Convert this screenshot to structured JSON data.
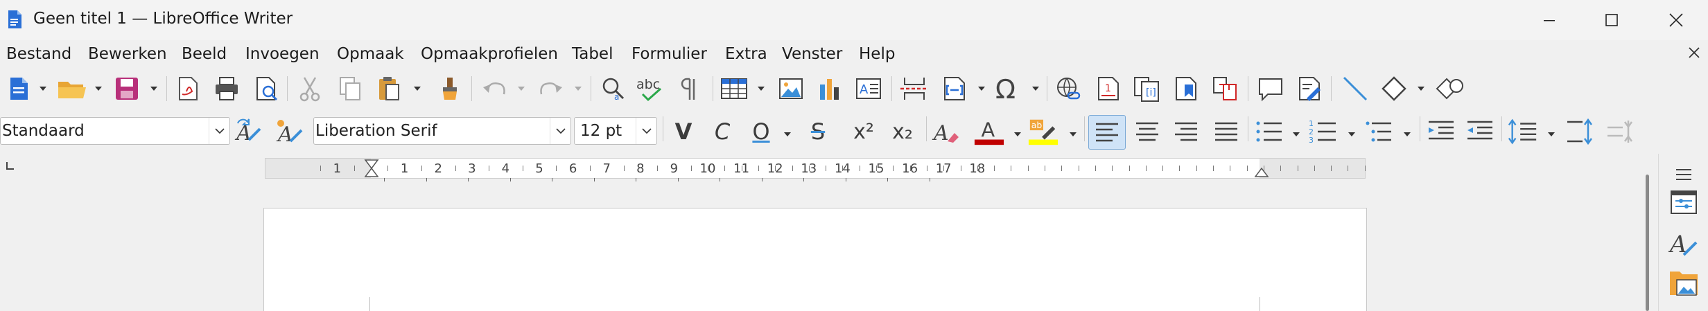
{
  "window": {
    "title": "Geen titel 1 — LibreOffice Writer"
  },
  "menu": [
    "Bestand",
    "Bewerken",
    "Beeld",
    "Invoegen",
    "Opmaak",
    "Opmaakprofielen",
    "Tabel",
    "Formulier",
    "Extra",
    "Venster",
    "Help"
  ],
  "formatting": {
    "paragraph_style": "Standaard",
    "font_name": "Liberation Serif",
    "font_size": "12 pt",
    "bold_label": "V",
    "italic_label": "C",
    "underline_label": "O",
    "strike_label": "S",
    "superscript_label": "x²",
    "subscript_label": "x₂",
    "font_color": "#c00000",
    "highlight_color": "#ffff00"
  },
  "ruler": {
    "labels": [
      "1",
      "1",
      "2",
      "3",
      "4",
      "5",
      "6",
      "7",
      "8",
      "9",
      "10",
      "11",
      "12",
      "13",
      "14",
      "15",
      "16",
      "17",
      "18"
    ]
  },
  "icons": {
    "toolbar1": [
      "new-document-icon",
      "open-icon",
      "save-icon",
      "export-pdf-icon",
      "print-icon",
      "print-preview-icon",
      "cut-icon",
      "copy-icon",
      "paste-icon",
      "clone-formatting-icon",
      "undo-icon",
      "redo-icon",
      "find-replace-icon",
      "spellcheck-icon",
      "formatting-marks-icon",
      "insert-table-icon",
      "insert-image-icon",
      "insert-chart-icon",
      "insert-textbox-icon",
      "page-break-icon",
      "insert-field-icon",
      "special-character-icon",
      "hyperlink-icon",
      "footnote-icon",
      "endnote-icon",
      "bookmark-icon",
      "cross-reference-icon",
      "comment-icon",
      "track-changes-icon",
      "line-icon",
      "basic-shapes-icon",
      "draw-functions-icon"
    ],
    "toolbar2": [
      "update-style-icon",
      "new-style-icon",
      "clear-formatting-icon",
      "font-color-icon",
      "highlight-icon",
      "align-left-icon",
      "align-center-icon",
      "align-right-icon",
      "justify-icon",
      "bullet-list-icon",
      "numbered-list-icon",
      "outline-list-icon",
      "increase-indent-icon",
      "decrease-indent-icon",
      "line-spacing-icon",
      "paragraph-spacing-increase-icon",
      "paragraph-spacing-decrease-icon"
    ],
    "sidebar": [
      "sidebar-menu-icon",
      "properties-icon",
      "styles-icon",
      "gallery-icon"
    ]
  }
}
